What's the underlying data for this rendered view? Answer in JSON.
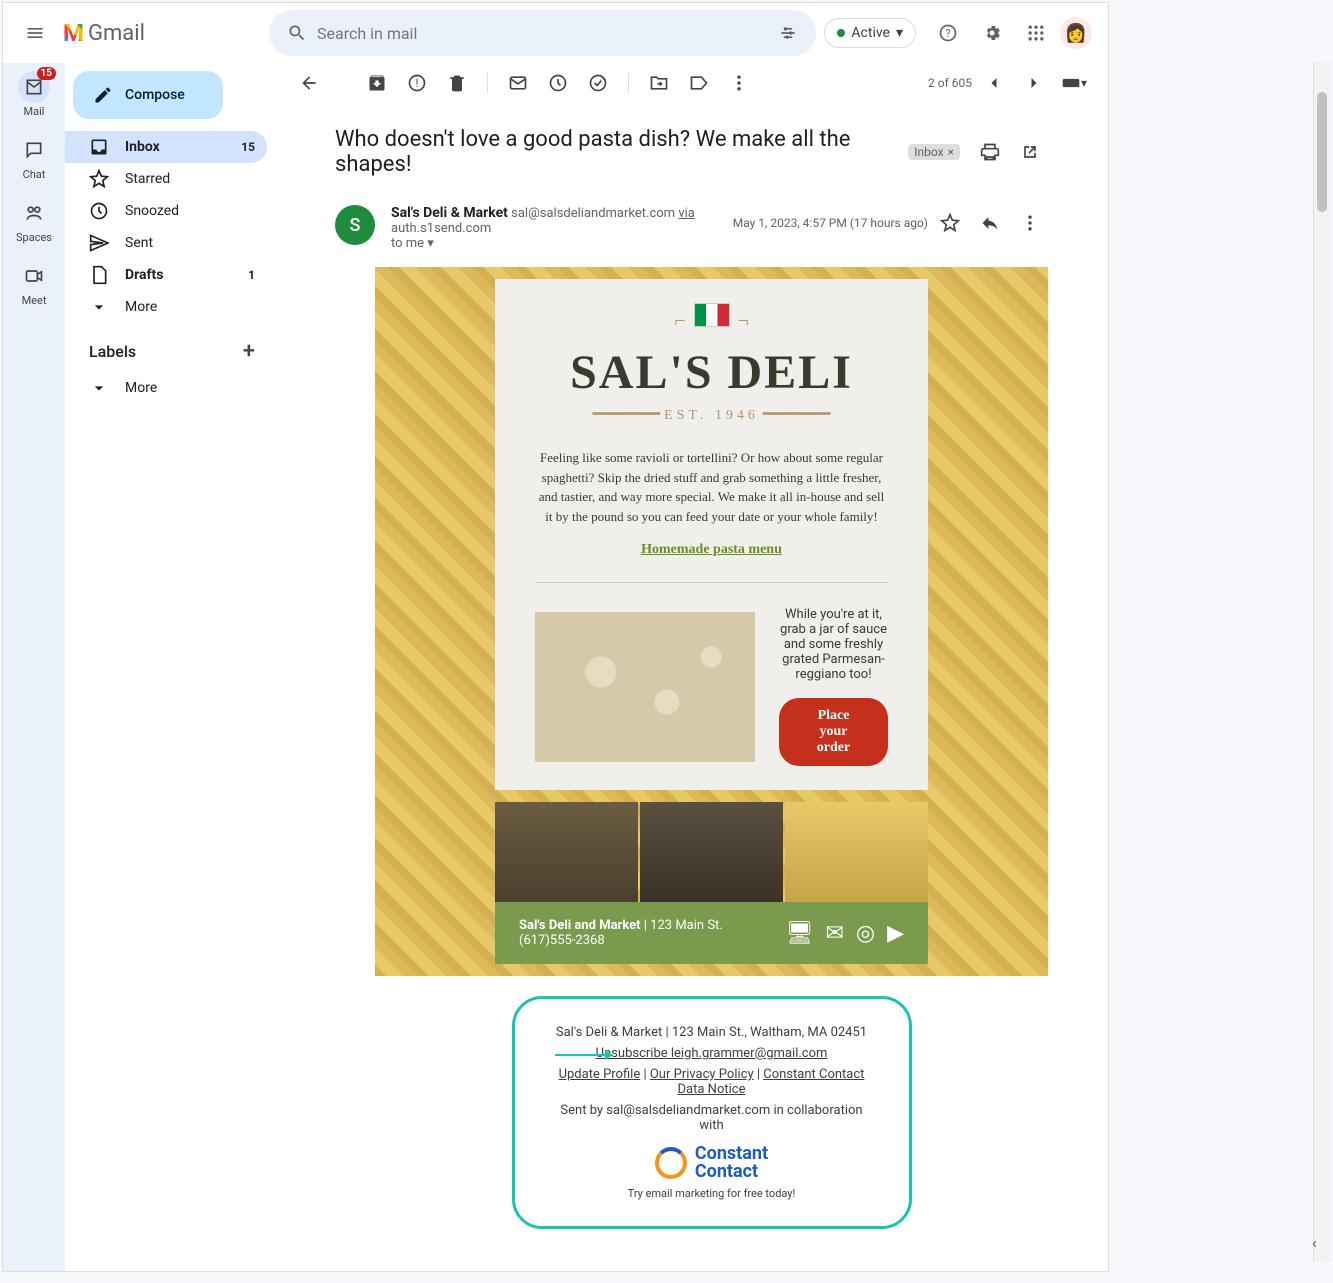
{
  "header": {
    "product": "Gmail",
    "search_placeholder": "Search in mail",
    "status": "Active"
  },
  "leftbar": {
    "mail": "Mail",
    "mail_badge": "15",
    "chat": "Chat",
    "spaces": "Spaces",
    "meet": "Meet"
  },
  "compose": "Compose",
  "nav": {
    "inbox": {
      "label": "Inbox",
      "count": "15"
    },
    "starred": "Starred",
    "snoozed": "Snoozed",
    "sent": "Sent",
    "drafts": {
      "label": "Drafts",
      "count": "1"
    },
    "more": "More"
  },
  "labels_header": "Labels",
  "labels_more": "More",
  "toolbar": {
    "pagination": "2 of 605"
  },
  "subject": {
    "text": "Who doesn't love a good pasta dish? We make all the shapes!",
    "chip": "Inbox"
  },
  "sender": {
    "initial": "S",
    "name": "Sal's Deli & Market",
    "email": "sal@salsdeliandmarket.com",
    "via": "via",
    "via_host": "auth.s1send.com",
    "to": "to me",
    "timestamp": "May 1, 2023, 4:57 PM (17 hours ago)"
  },
  "email": {
    "brand": "SAL'S DELI",
    "est": "EST. 1946",
    "body": "Feeling like some ravioli or tortellini? Or how about some regular spaghetti? Skip the dried stuff and grab something a little fresher, and tastier, and way more special. We make it all in-house and sell it by the pound so you can feed your date or your whole family!",
    "menu_link": "Homemade pasta menu",
    "side_text": "While you're at it, grab a jar of sauce and some freshly grated Parmesan-reggiano too!",
    "order_btn": "Place your order",
    "footer_name": "Sal's Deli and Market",
    "footer_addr": " | 123 Main St.",
    "footer_phone": "(617)555-2368"
  },
  "unsub": {
    "line1": "Sal's Deli & Market | 123 Main St., Waltham, MA 02451",
    "unsubscribe": "Unsubscribe leigh.grammer@gmail.com",
    "update": "Update Profile",
    "privacy": "Our Privacy Policy",
    "ccnotice": "Constant Contact Data Notice",
    "sentby": "Sent by sal@salsdeliandmarket.com in collaboration with",
    "cc_name": "Constant Contact",
    "try": "Try email marketing for free today!"
  }
}
